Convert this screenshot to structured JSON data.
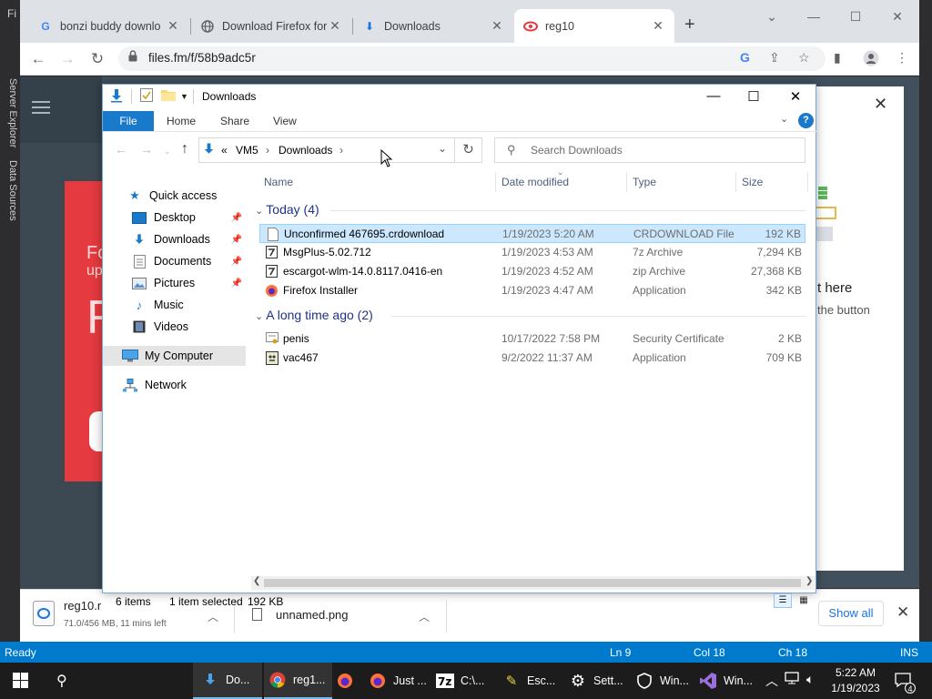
{
  "vs": {
    "menu_partial": "Fi",
    "side_tabs": [
      "Server Explorer",
      "Data Sources"
    ],
    "status": {
      "ready": "Ready",
      "ln": "Ln 9",
      "col": "Col 18",
      "ch": "Ch 18",
      "ins": "INS"
    }
  },
  "chrome": {
    "tabs": [
      {
        "label": "bonzi buddy downlo",
        "icon": "google-icon",
        "close": "✕"
      },
      {
        "label": "Download Firefox for",
        "icon": "globe-icon",
        "close": "✕"
      },
      {
        "label": "Downloads",
        "icon": "download-icon",
        "close": "✕"
      },
      {
        "label": "reg10",
        "icon": "files-fm-icon",
        "close": "✕",
        "active": true
      }
    ],
    "new_tab": "+",
    "url": "files.fm/f/58b9adc5r",
    "page": {
      "red_card_lines": [
        "Fo",
        "up",
        "R"
      ],
      "modal_title_partial": "t here",
      "modal_sub_partial": "the button"
    },
    "downloads": [
      {
        "name": "reg10.r",
        "status": "71.0/456 MB, 11 mins left"
      },
      {
        "name": "unnamed.png"
      }
    ],
    "show_all": "Show all"
  },
  "explorer": {
    "title": "Downloads",
    "ribbon": {
      "file": "File",
      "tabs": [
        "Home",
        "Share",
        "View"
      ],
      "help": "?"
    },
    "address": {
      "prefix": "«",
      "crumbs": [
        "VM5",
        "Downloads"
      ]
    },
    "search_placeholder": "Search Downloads",
    "nav": [
      {
        "label": "Quick access",
        "icon": "star-icon",
        "pinned": false
      },
      {
        "label": "Desktop",
        "icon": "desktop-icon",
        "pinned": true
      },
      {
        "label": "Downloads",
        "icon": "download-icon",
        "pinned": true
      },
      {
        "label": "Documents",
        "icon": "documents-icon",
        "pinned": true
      },
      {
        "label": "Pictures",
        "icon": "pictures-icon",
        "pinned": true
      },
      {
        "label": "Music",
        "icon": "music-icon",
        "pinned": false
      },
      {
        "label": "Videos",
        "icon": "videos-icon",
        "pinned": false
      },
      {
        "label": "My Computer",
        "icon": "computer-icon",
        "pinned": false,
        "selected": true
      },
      {
        "label": "Network",
        "icon": "network-icon",
        "pinned": false
      }
    ],
    "columns": [
      "Name",
      "Date modified",
      "Type",
      "Size"
    ],
    "groups": [
      {
        "title": "Today (4)",
        "files": [
          {
            "name": "Unconfirmed 467695.crdownload",
            "date": "1/19/2023 5:20 AM",
            "type": "CRDOWNLOAD File",
            "size": "192 KB",
            "selected": true
          },
          {
            "name": "MsgPlus-5.02.712",
            "date": "1/19/2023 4:53 AM",
            "type": "7z Archive",
            "size": "7,294 KB"
          },
          {
            "name": "escargot-wlm-14.0.8117.0416-en",
            "date": "1/19/2023 4:52 AM",
            "type": "zip Archive",
            "size": "27,368 KB"
          },
          {
            "name": "Firefox Installer",
            "date": "1/19/2023 4:47 AM",
            "type": "Application",
            "size": "342 KB"
          }
        ]
      },
      {
        "title": "A long time ago (2)",
        "files": [
          {
            "name": "penis",
            "date": "10/17/2022 7:58 PM",
            "type": "Security Certificate",
            "size": "2 KB"
          },
          {
            "name": "vac467",
            "date": "9/2/2022 11:37 AM",
            "type": "Application",
            "size": "709 KB"
          }
        ]
      }
    ],
    "status": {
      "items": "6 items",
      "selected": "1 item selected",
      "size": "192 KB"
    }
  },
  "taskbar": {
    "items": [
      {
        "label": "Do...",
        "icon": "explorer-download-icon",
        "active": true
      },
      {
        "label": "reg1...",
        "icon": "chrome-icon",
        "active": true
      },
      {
        "label": "",
        "icon": "firefox-icon"
      },
      {
        "label": "Just ...",
        "icon": "firefox-icon"
      },
      {
        "label": "C:\\...",
        "icon": "7zip-icon"
      },
      {
        "label": "Esc...",
        "icon": "escargot-icon"
      },
      {
        "label": "Sett...",
        "icon": "settings-icon"
      },
      {
        "label": "Win...",
        "icon": "security-icon"
      },
      {
        "label": "Win...",
        "icon": "visual-studio-icon"
      }
    ],
    "time": "5:22 AM",
    "date": "1/19/2023",
    "notifications": "4"
  },
  "colors": {
    "accent": "#1979ca",
    "vs_status": "#007acc",
    "selection": "#cce8ff"
  }
}
